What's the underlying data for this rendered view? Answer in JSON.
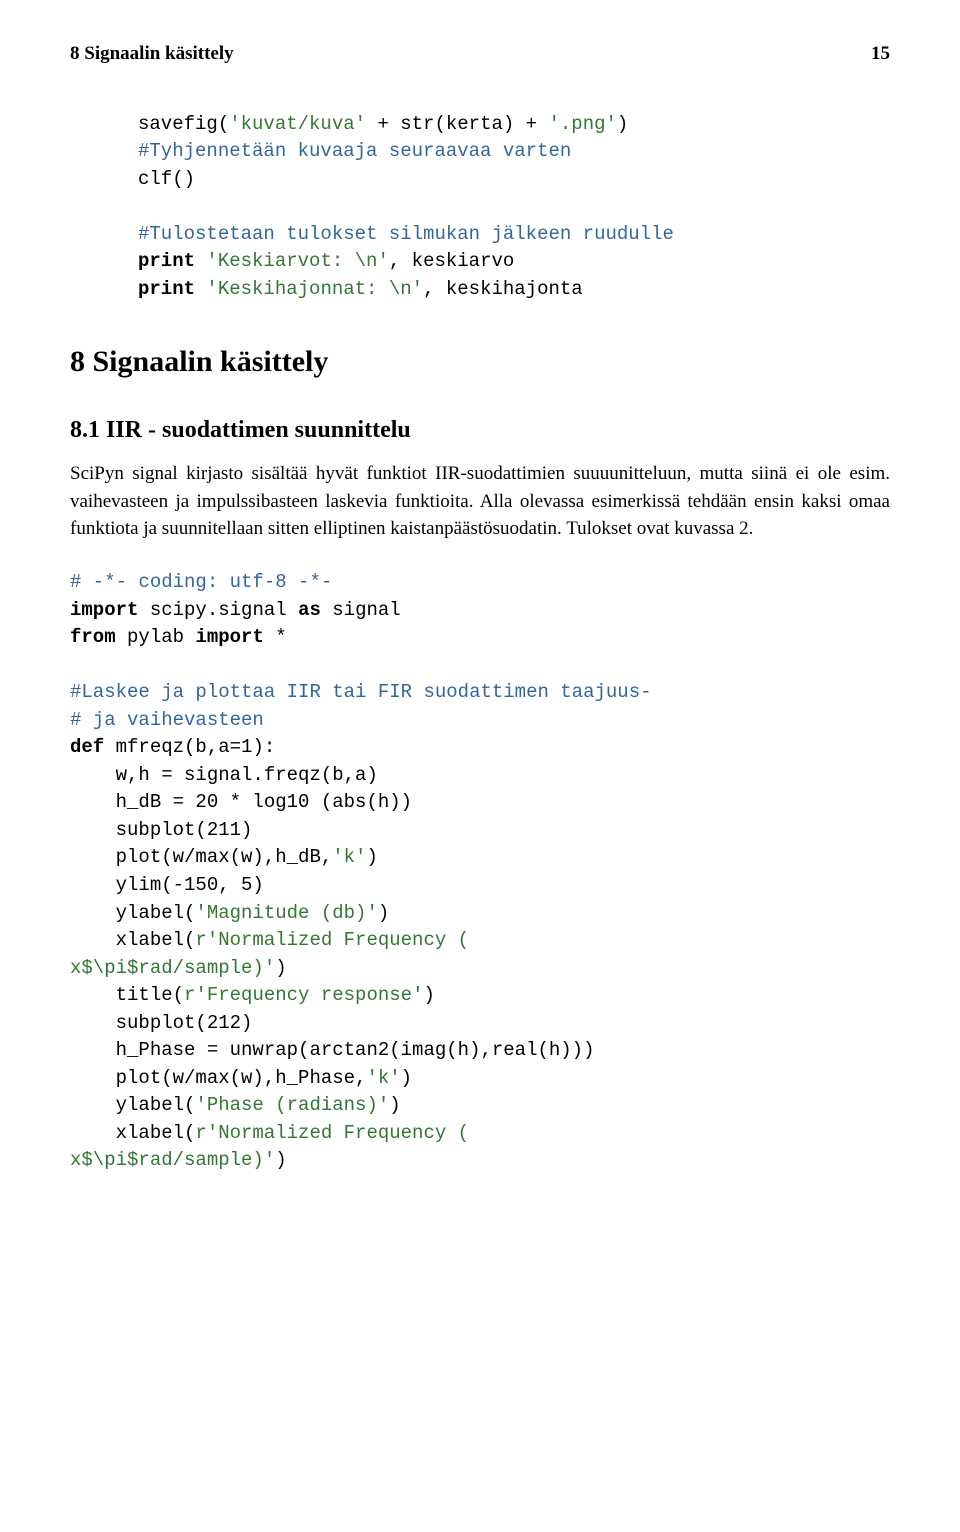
{
  "header": {
    "title": "8 Signaalin käsittely",
    "page": "15"
  },
  "code1": {
    "l1a": "savefig(",
    "l1b": "'kuvat/kuva'",
    "l1c": " + str(kerta) + ",
    "l1d": "'.png'",
    "l1e": ")",
    "l2": "#Tyhjennetään kuvaaja seuraavaa varten",
    "l3": "clf()",
    "l4": "",
    "l5": "#Tulostetaan tulokset silmukan jälkeen ruudulle",
    "l6a": "print",
    "l6b": " ",
    "l6c": "'Keskiarvot: \\n'",
    "l6d": ", keskiarvo",
    "l7a": "print",
    "l7b": " ",
    "l7c": "'Keskihajonnat: \\n'",
    "l7d": ", keskihajonta"
  },
  "sec": {
    "h1": "8   Signaalin käsittely",
    "h2": "8.1   IIR - suodattimen suunnittelu",
    "body": "SciPyn signal kirjasto sisältää hyvät funktiot IIR-suodattimien suuuunitteluun, mutta siinä ei ole esim. vaihevasteen ja impulssibasteen laskevia funktioita. Alla olevassa esimerkissä tehdään ensin kaksi omaa funktiota ja suunnitellaan sitten elliptinen kaistanpäästösuodatin. Tulokset ovat kuvassa 2."
  },
  "code2": {
    "l1": "# -*- coding: utf-8 -*-",
    "l2a": "import",
    "l2b": " scipy.signal ",
    "l2c": "as",
    "l2d": " signal",
    "l3a": "from",
    "l3b": " pylab ",
    "l3c": "import",
    "l3d": " *",
    "l4": "",
    "l5": "#Laskee ja plottaa IIR tai FIR suodattimen taajuus-",
    "l6": "# ja vaihevasteen",
    "l7a": "def",
    "l7b": " mfreqz(b,a=1):",
    "l8": "    w,h = signal.freqz(b,a)",
    "l9": "    h_dB = 20 * log10 (abs(h))",
    "l10": "    subplot(211)",
    "l11a": "    plot(w/max(w),h_dB,",
    "l11b": "'k'",
    "l11c": ")",
    "l12": "    ylim(-150, 5)",
    "l13a": "    ylabel(",
    "l13b": "'Magnitude (db)'",
    "l13c": ")",
    "l14a": "    xlabel(",
    "l14b": "r'Normalized Frequency (",
    "l15": "x$\\pi$rad/sample)'",
    "l15c": ")",
    "l16a": "    title(",
    "l16b": "r'Frequency response'",
    "l16c": ")",
    "l17": "    subplot(212)",
    "l18": "    h_Phase = unwrap(arctan2(imag(h),real(h)))",
    "l19a": "    plot(w/max(w),h_Phase,",
    "l19b": "'k'",
    "l19c": ")",
    "l20a": "    ylabel(",
    "l20b": "'Phase (radians)'",
    "l20c": ")",
    "l21a": "    xlabel(",
    "l21b": "r'Normalized Frequency (",
    "l22": "x$\\pi$rad/sample)'",
    "l22c": ")"
  }
}
